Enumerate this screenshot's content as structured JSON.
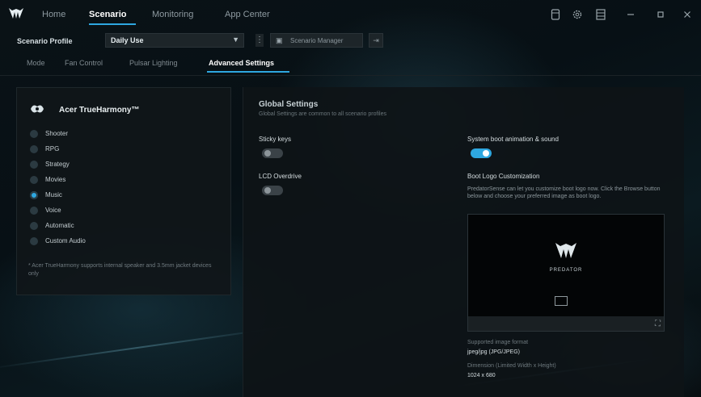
{
  "app": {
    "nav": [
      "Home",
      "Scenario",
      "Monitoring",
      "App Center"
    ],
    "active_nav": "Scenario"
  },
  "window_controls": {
    "icons": [
      "device-icon",
      "settings-icon",
      "grid-icon",
      "minimize-icon",
      "maximize-icon",
      "close-icon"
    ]
  },
  "profile": {
    "label": "Scenario Profile",
    "value": "Daily Use",
    "manager_label": "Scenario Manager"
  },
  "tabs": [
    "Mode",
    "Fan Control",
    "Pulsar Lighting",
    "Advanced Settings"
  ],
  "left_panel": {
    "title": "Acer TrueHarmony™",
    "modes": [
      "Shooter",
      "RPG",
      "Strategy",
      "Movies",
      "Music",
      "Voice",
      "Automatic",
      "Custom Audio"
    ],
    "selected_mode": "Music",
    "footnote": "* Acer TrueHarmony supports internal speaker and 3.5mm jacket devices only"
  },
  "global_settings": {
    "title": "Global Settings",
    "subtitle": "Global Settings are common to all scenario profiles",
    "sticky_keys_label": "Sticky keys",
    "sticky_keys_on": false,
    "lcd_overdrive_label": "LCD Overdrive",
    "lcd_overdrive_on": false,
    "boot_anim_label": "System boot animation & sound",
    "boot_anim_on": true,
    "boot_logo_title": "Boot Logo Customization",
    "boot_logo_desc": "PredatorSense can let you customize boot logo now. Click the Browse button below and choose your preferred image as boot logo.",
    "preview_brand": "PREDATOR",
    "supported_format_label": "Supported image format",
    "supported_format_value": "jpeg/jpg (JPG/JPEG)",
    "dimension_label": "Dimension (Limited Width x Height)",
    "dimension_value": "1024 x 680"
  },
  "colors": {
    "accent": "#2ea7e0",
    "background": "#07090b",
    "panel": "#10161a"
  }
}
